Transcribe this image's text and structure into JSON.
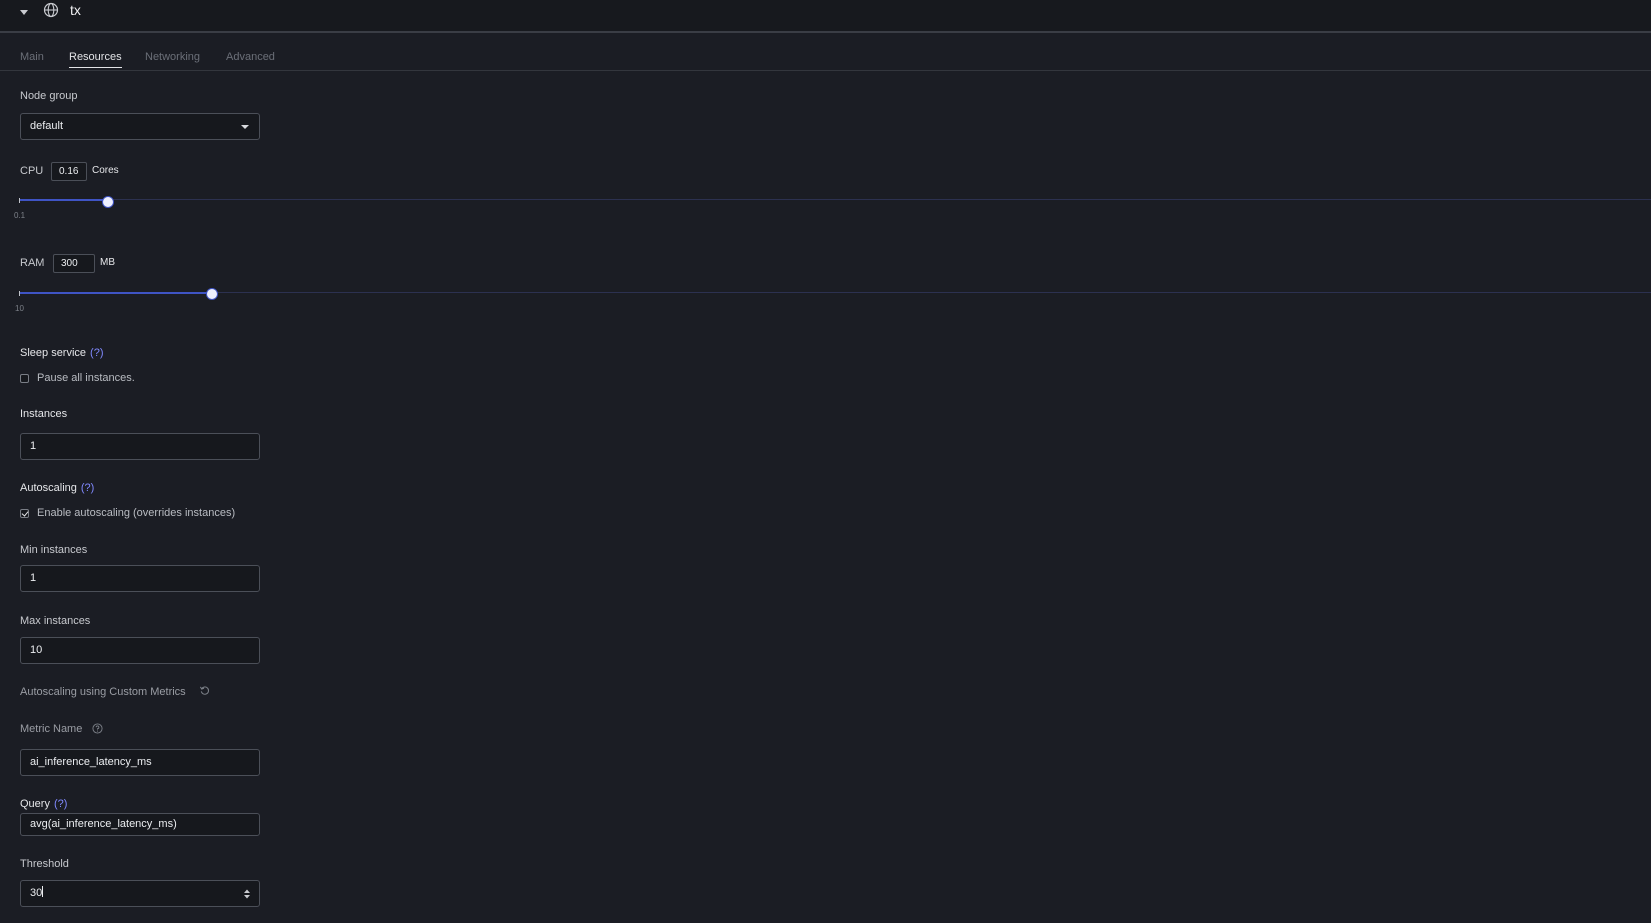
{
  "header": {
    "title": "tx",
    "collapse_icon": "chevron-down-icon",
    "service_icon": "globe-icon"
  },
  "tabs": [
    {
      "label": "Main",
      "active": false
    },
    {
      "label": "Resources",
      "active": true
    },
    {
      "label": "Networking",
      "active": false
    },
    {
      "label": "Advanced",
      "active": false
    }
  ],
  "node_group": {
    "label": "Node group",
    "value": "default"
  },
  "cpu": {
    "label": "CPU",
    "value": "0.16",
    "unit": "Cores",
    "min_label": "0.1"
  },
  "ram": {
    "label": "RAM",
    "value": "300",
    "unit": "MB",
    "min_label": "10"
  },
  "sleep": {
    "label": "Sleep service",
    "help": "(?)",
    "checkbox_label": "Pause all instances.",
    "checked": false
  },
  "instances": {
    "label": "Instances",
    "value": "1"
  },
  "autoscaling": {
    "label": "Autoscaling",
    "help": "(?)",
    "checkbox_label": "Enable autoscaling (overrides instances)",
    "checked": true
  },
  "min_instances": {
    "label": "Min instances",
    "value": "1"
  },
  "max_instances": {
    "label": "Max instances",
    "value": "10"
  },
  "custom_metrics": {
    "label": "Autoscaling using Custom Metrics",
    "icon": "reset-icon"
  },
  "metric_name": {
    "label": "Metric Name",
    "icon": "help-circle-icon",
    "value": "ai_inference_latency_ms"
  },
  "query": {
    "label": "Query",
    "help": "(?)",
    "value": "avg(ai_inference_latency_ms)"
  },
  "threshold": {
    "label": "Threshold",
    "value": "30"
  },
  "colors": {
    "background": "#1b1d24",
    "accent": "#3f54c5",
    "help_link": "#8089ff"
  }
}
